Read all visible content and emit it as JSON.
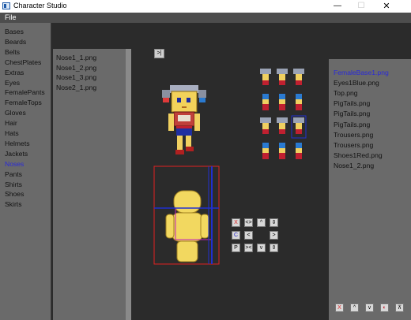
{
  "window": {
    "title": "Character Studio",
    "minimize_label": "—",
    "maximize_label": "☐",
    "close_label": "✕"
  },
  "menu": {
    "file_label": "File"
  },
  "categories": [
    {
      "label": "Bases",
      "selected": false
    },
    {
      "label": "Beards",
      "selected": false
    },
    {
      "label": "Belts",
      "selected": false
    },
    {
      "label": "ChestPlates",
      "selected": false
    },
    {
      "label": "Extras",
      "selected": false
    },
    {
      "label": "Eyes",
      "selected": false
    },
    {
      "label": "FemalePants",
      "selected": false
    },
    {
      "label": "FemaleTops",
      "selected": false
    },
    {
      "label": "Gloves",
      "selected": false
    },
    {
      "label": "Hair",
      "selected": false
    },
    {
      "label": "Hats",
      "selected": false
    },
    {
      "label": "Helmets",
      "selected": false
    },
    {
      "label": "Jackets",
      "selected": false
    },
    {
      "label": "Noses",
      "selected": true
    },
    {
      "label": "Pants",
      "selected": false
    },
    {
      "label": "Shirts",
      "selected": false
    },
    {
      "label": "Shoes",
      "selected": false
    },
    {
      "label": "Skirts",
      "selected": false
    }
  ],
  "files": [
    "Nose1_1.png",
    "Nose1_2.png",
    "Nose1_3.png",
    "Nose2_1.png"
  ],
  "toggle_label": ">|",
  "layers": [
    {
      "label": "FemaleBase1.png",
      "selected": true
    },
    {
      "label": "Eyes1Blue.png",
      "selected": false
    },
    {
      "label": "Top.png",
      "selected": false
    },
    {
      "label": "PigTails.png",
      "selected": false
    },
    {
      "label": "PigTails.png",
      "selected": false
    },
    {
      "label": "PigTails.png",
      "selected": false
    },
    {
      "label": "Trousers.png",
      "selected": false
    },
    {
      "label": "Trousers.png",
      "selected": false
    },
    {
      "label": "Shoes1Red.png",
      "selected": false
    },
    {
      "label": "Nose1_2.png",
      "selected": false
    }
  ],
  "controls": {
    "delete": "X",
    "swap_h": "<>",
    "up": "^",
    "move_v": "⇕",
    "color": "C",
    "left": "<",
    "right": ">",
    "pivot": "P",
    "shrink_h": "><",
    "down": "v",
    "flip_v": "⇕"
  },
  "layer_controls": {
    "delete": "X",
    "up": "^",
    "down": "v",
    "color": "◐",
    "top": "⊼"
  },
  "colors": {
    "selected_text": "#2a2ad8",
    "hair": "#9aa2b4",
    "hair_tie": "#e0403a",
    "skin": "#f0d060",
    "top": "#c02030",
    "trousers": "#1f2fa0",
    "shoes": "#b02020",
    "frame_red": "#e02020",
    "guide_blue": "#2030d0"
  }
}
